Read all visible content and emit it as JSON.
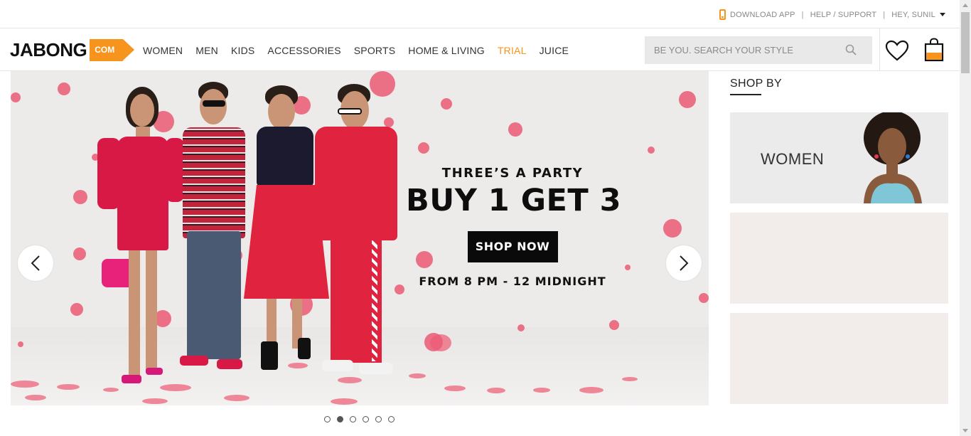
{
  "top_links": {
    "download_app": "DOWNLOAD APP",
    "separator": "|",
    "help": "HELP / SUPPORT",
    "greeting": "HEY, SUNIL"
  },
  "logo": {
    "name": "JABONG",
    "suffix": "COM"
  },
  "nav": {
    "items": [
      "WOMEN",
      "MEN",
      "KIDS",
      "ACCESSORIES",
      "SPORTS",
      "HOME & LIVING",
      "TRIAL",
      "JUICE"
    ],
    "accent_item": "TRIAL"
  },
  "search": {
    "placeholder": "BE YOU. SEARCH YOUR STYLE"
  },
  "icons": {
    "wishlist": "heart-icon",
    "cart": "shopping-bag-icon",
    "search": "search-icon",
    "app": "phone-icon"
  },
  "hero": {
    "subtitle": "THREE’S A PARTY",
    "headline": "BUY 1 GET 3",
    "cta": "SHOP NOW",
    "timing": "FROM 8 PM - 12 MIDNIGHT",
    "slide_count": 6,
    "active_slide": 2
  },
  "shop_by": {
    "title": "SHOP BY",
    "cards": [
      {
        "label": "WOMEN"
      },
      {
        "label": ""
      },
      {
        "label": ""
      }
    ]
  },
  "colors": {
    "accent": "#f7941d",
    "brand_text": "#111111",
    "hero_dots": "#ec5a73"
  }
}
